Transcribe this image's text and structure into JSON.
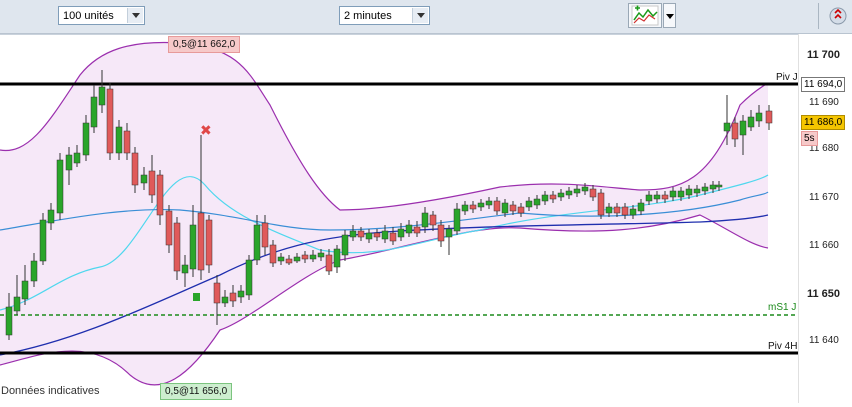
{
  "toolbar": {
    "quantity": "100 unités",
    "timeframe": "2 minutes"
  },
  "axis": {
    "ticks": [
      {
        "label": "11 700",
        "major": true
      },
      {
        "label": "11 690",
        "major": false
      },
      {
        "label": "11 680",
        "major": false
      },
      {
        "label": "11 670",
        "major": false
      },
      {
        "label": "11 660",
        "major": false
      },
      {
        "label": "11 650",
        "major": true
      },
      {
        "label": "11 640",
        "major": false
      }
    ],
    "pivot_value": "11 694,0",
    "last_price": "11 686,0",
    "countdown": "5s"
  },
  "levels": {
    "piv_day": "Piv J",
    "ms1_day": "mS1 J",
    "piv_4h": "Piv 4H"
  },
  "markers": {
    "high_label": "0,5@11 662,0",
    "low_label": "0,5@11 656,0"
  },
  "footer": "Données indicatives",
  "colors": {
    "bull": "#2aa52a",
    "bear": "#e05a5a",
    "bollinger": "#9b2fae",
    "ma_light": "#4fd7ee",
    "ma_mid": "#3a8ed6",
    "ma_slow": "#1f2fae",
    "pivot": "#000000",
    "ms1": "#1b8a1b"
  }
}
